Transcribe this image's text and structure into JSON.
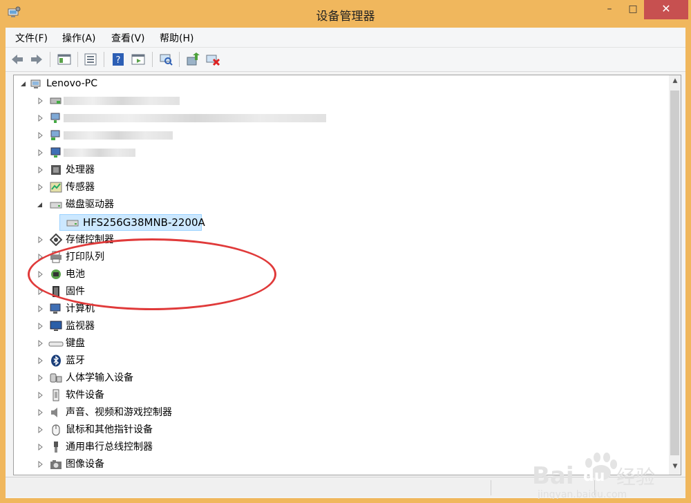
{
  "window": {
    "title": "设备管理器",
    "close_glyph": "✕",
    "min_glyph": "–",
    "max_glyph": "□"
  },
  "menu": [
    {
      "id": "file",
      "label": "文件(F)"
    },
    {
      "id": "action",
      "label": "操作(A)"
    },
    {
      "id": "view",
      "label": "查看(V)"
    },
    {
      "id": "help",
      "label": "帮助(H)"
    }
  ],
  "tree": {
    "root": "Lenovo-PC",
    "categories": [
      {
        "label": "处理器",
        "icon": "processor-icon"
      },
      {
        "label": "传感器",
        "icon": "sensor-icon"
      },
      {
        "label": "磁盘驱动器",
        "icon": "disk-drive-icon",
        "expanded": true
      },
      {
        "label": "存储控制器",
        "icon": "storage-controller-icon"
      },
      {
        "label": "打印队列",
        "icon": "printer-icon"
      },
      {
        "label": "电池",
        "icon": "battery-icon"
      },
      {
        "label": "固件",
        "icon": "firmware-icon"
      },
      {
        "label": "计算机",
        "icon": "computer-icon"
      },
      {
        "label": "监视器",
        "icon": "monitor-icon"
      },
      {
        "label": "键盘",
        "icon": "keyboard-icon"
      },
      {
        "label": "蓝牙",
        "icon": "bluetooth-icon"
      },
      {
        "label": "人体学输入设备",
        "icon": "hid-icon"
      },
      {
        "label": "软件设备",
        "icon": "software-device-icon"
      },
      {
        "label": "声音、视频和游戏控制器",
        "icon": "sound-icon"
      },
      {
        "label": "鼠标和其他指针设备",
        "icon": "mouse-icon"
      },
      {
        "label": "通用串行总线控制器",
        "icon": "usb-icon"
      },
      {
        "label": "图像设备",
        "icon": "camera-icon"
      }
    ],
    "disk_child": "HFS256G38MNB-2200A"
  },
  "watermark": {
    "brand": "Bai",
    "brand2": "du",
    "cn": "经验",
    "url": "jingyan.baidu.com"
  },
  "colors": {
    "frame": "#f0b75d",
    "selection": "#cce8ff",
    "annotation": "#e03a3a"
  }
}
